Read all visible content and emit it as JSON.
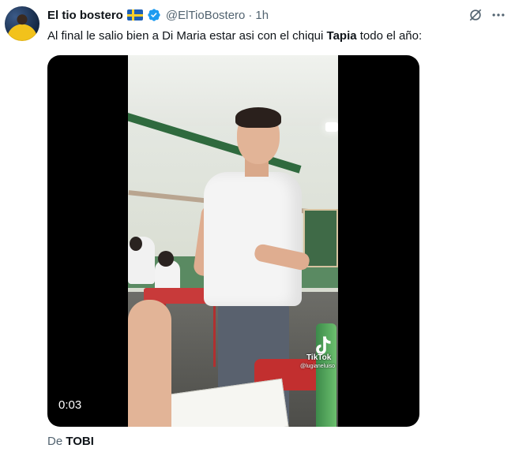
{
  "author": {
    "display_name": "El tio bostero",
    "flag_icon": "sweden-flag-icon",
    "verified_icon": "verified-badge-icon",
    "handle": "@ElTioBostero",
    "separator": "·",
    "time": "1h"
  },
  "tweet": {
    "text_before": "Al final le salio bien a Di Maria estar asi con el chiqui ",
    "text_bold": "Tapia",
    "text_after": " todo el año:"
  },
  "video": {
    "duration": "0:03",
    "watermark_label": "TikTok",
    "watermark_user": "@lugianeluiso"
  },
  "attribution": {
    "prefix": "De ",
    "source_name": "TOBI"
  },
  "colors": {
    "verified": "#1d9bf0",
    "secondary_text": "#536471",
    "primary_text": "#0f1419"
  }
}
